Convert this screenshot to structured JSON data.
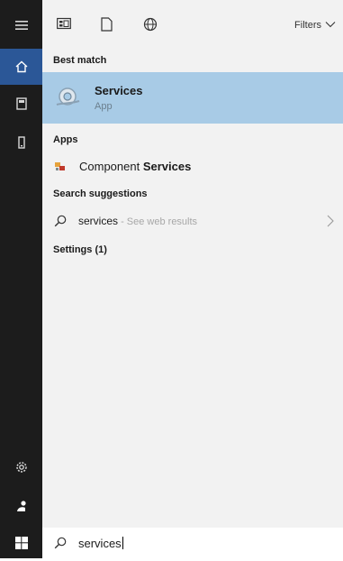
{
  "rail": {
    "items": [
      {
        "name": "menu",
        "icon": "hamburger-icon"
      },
      {
        "name": "home",
        "icon": "home-icon",
        "active": true
      },
      {
        "name": "documents",
        "icon": "document-icon"
      },
      {
        "name": "device",
        "icon": "device-icon"
      },
      {
        "name": "settings",
        "icon": "gear-icon"
      },
      {
        "name": "user",
        "icon": "user-icon"
      },
      {
        "name": "start",
        "icon": "windows-icon"
      }
    ]
  },
  "topbar": {
    "icons": [
      "apps-icon",
      "document-icon",
      "web-icon"
    ],
    "filters_label": "Filters"
  },
  "best_match": {
    "section": "Best match",
    "title": "Services",
    "subtitle": "App"
  },
  "apps": {
    "section": "Apps",
    "item_prefix": "Component ",
    "item_match": "Services"
  },
  "suggestions": {
    "section": "Search suggestions",
    "query": "services",
    "hint": " - See web results"
  },
  "settings": {
    "section": "Settings (1)"
  },
  "search": {
    "value": "services"
  },
  "colors": {
    "rail_bg": "#1c1c1c",
    "rail_active": "#2b5797",
    "panel_bg": "#f2f2f2",
    "selected_row": "#a8cbe6"
  }
}
